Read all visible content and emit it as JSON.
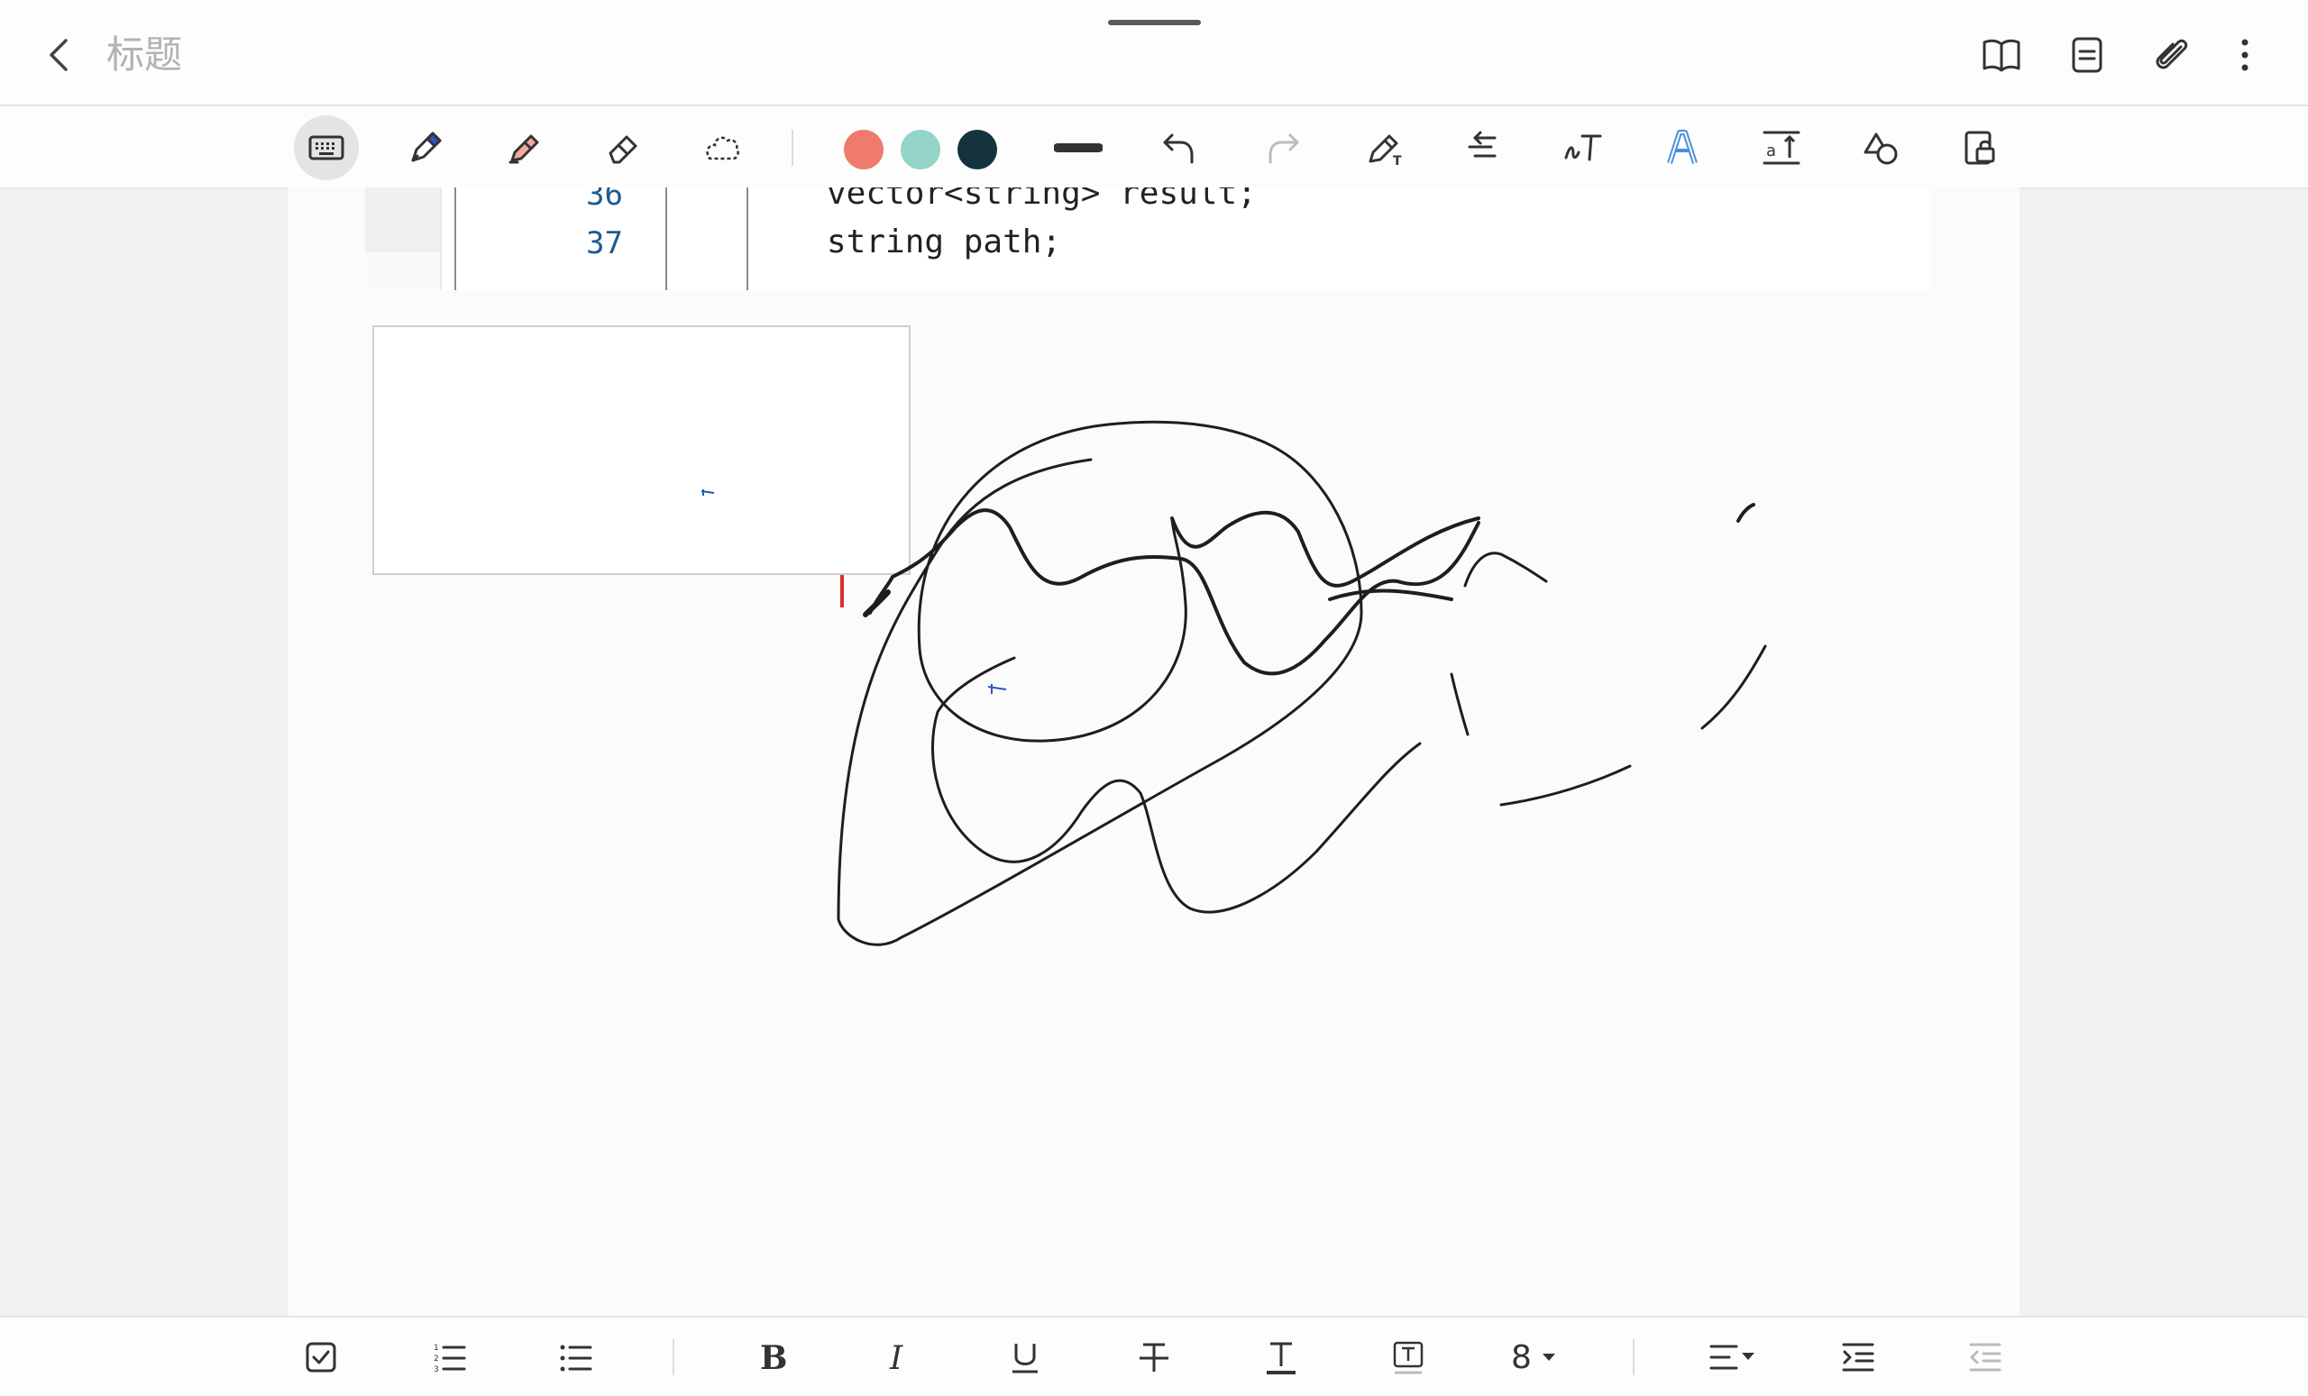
{
  "header": {
    "title": "标题"
  },
  "toolbar": {
    "tools": [
      "keyboard",
      "pen",
      "highlighter",
      "eraser",
      "lasso"
    ],
    "colors": [
      "#ee7b6b",
      "#93d3c8",
      "#15333f"
    ],
    "selected_tool": "keyboard"
  },
  "code_snippet": {
    "lines": [
      {
        "number": "36",
        "code": "vector<string> result;"
      },
      {
        "number": "37",
        "code": "string path;"
      }
    ]
  },
  "format_bar": {
    "font_size": "8"
  }
}
